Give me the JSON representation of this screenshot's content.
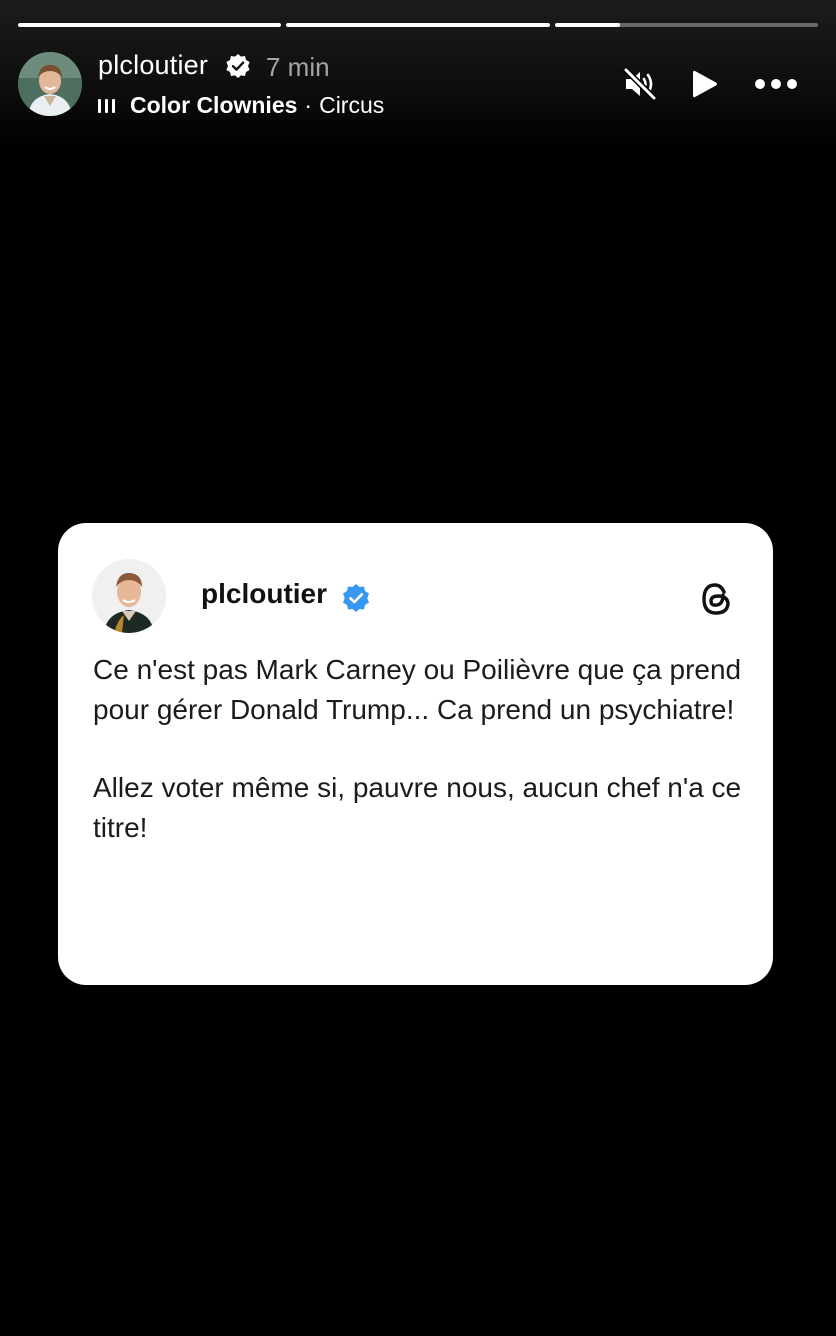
{
  "story": {
    "progress": [
      1.0,
      1.0,
      0.25
    ],
    "header": {
      "username": "plcloutier",
      "time": "7 min",
      "music": {
        "song": "Color Clownies",
        "separator": "·",
        "artist": "Circus"
      },
      "icons": [
        "mute-icon",
        "play-icon",
        "more-icon",
        "verified-icon"
      ]
    }
  },
  "post_card": {
    "username": "plcloutier",
    "paragraphs": [
      "Ce n'est pas Mark Carney ou Poilièvre que ça prend pour gérer Donald Trump... Ca prend un psychiatre!",
      "Allez voter même si, pauvre nous, aucun chef n'a ce titre!"
    ],
    "icons": [
      "verified-badge-icon",
      "threads-logo-icon"
    ],
    "colors": {
      "badge": "#3897f0",
      "card_background": "#ffffff"
    }
  }
}
